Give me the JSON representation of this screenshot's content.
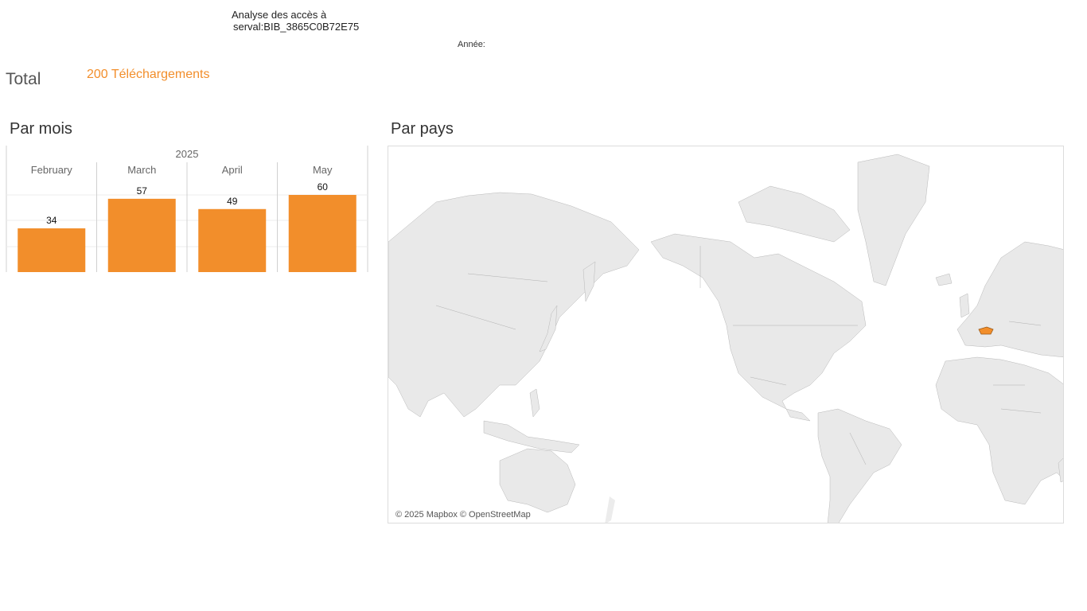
{
  "header": {
    "title_line1": "Analyse des accès à",
    "title_line2": "serval:BIB_3865C0B72E75",
    "year_filter_label": "Année:"
  },
  "total": {
    "label": "Total",
    "value_text": "200 Téléchargements"
  },
  "colors": {
    "accent": "#f28e2b",
    "land": "#e8e8e8",
    "highlight_country": "#f28e2b",
    "border": "#9a9a9a"
  },
  "by_month": {
    "title": "Par mois"
  },
  "by_country": {
    "title": "Par pays",
    "attribution": "© 2025 Mapbox © OpenStreetMap",
    "highlighted": "Switzerland"
  },
  "chart_data": {
    "type": "bar",
    "group_label": "2025",
    "categories": [
      "February",
      "March",
      "April",
      "May"
    ],
    "values": [
      34,
      57,
      49,
      60
    ],
    "data_labels": [
      "34",
      "57",
      "49",
      "60"
    ],
    "ylim": [
      0,
      60
    ],
    "grid": true,
    "title": "",
    "xlabel": "",
    "ylabel": ""
  }
}
